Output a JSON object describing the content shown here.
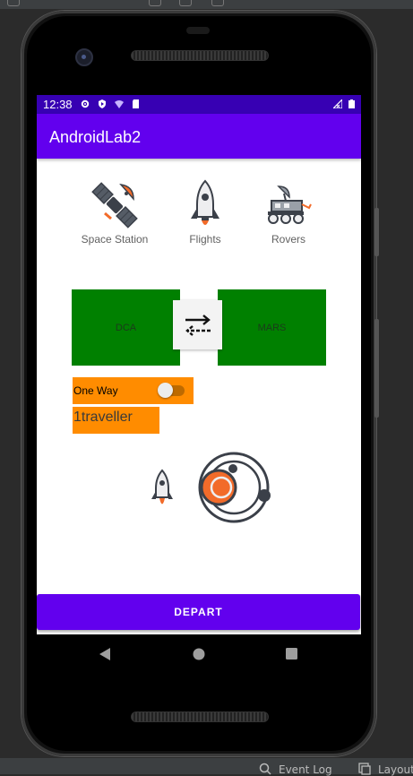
{
  "app": {
    "title": "AndroidLab2"
  },
  "status_bar": {
    "time": "12:38"
  },
  "categories": [
    {
      "label": "Space Station",
      "icon": "satellite-icon"
    },
    {
      "label": "Flights",
      "icon": "rocket-icon"
    },
    {
      "label": "Rovers",
      "icon": "rover-icon"
    }
  ],
  "route": {
    "from": "DCA",
    "to": "MARS",
    "swap_icon": "swap-arrows-icon"
  },
  "trip": {
    "one_way_label": "One Way",
    "one_way_on": false,
    "travellers": "1traveller"
  },
  "depart": {
    "label": "DEPART"
  },
  "ide": {
    "event_log": "Event Log",
    "layout": "Layout"
  },
  "colors": {
    "primary": "#6200ee",
    "primary_dark": "#3700b3",
    "box": "#008000",
    "accent": "#ff8c00"
  }
}
